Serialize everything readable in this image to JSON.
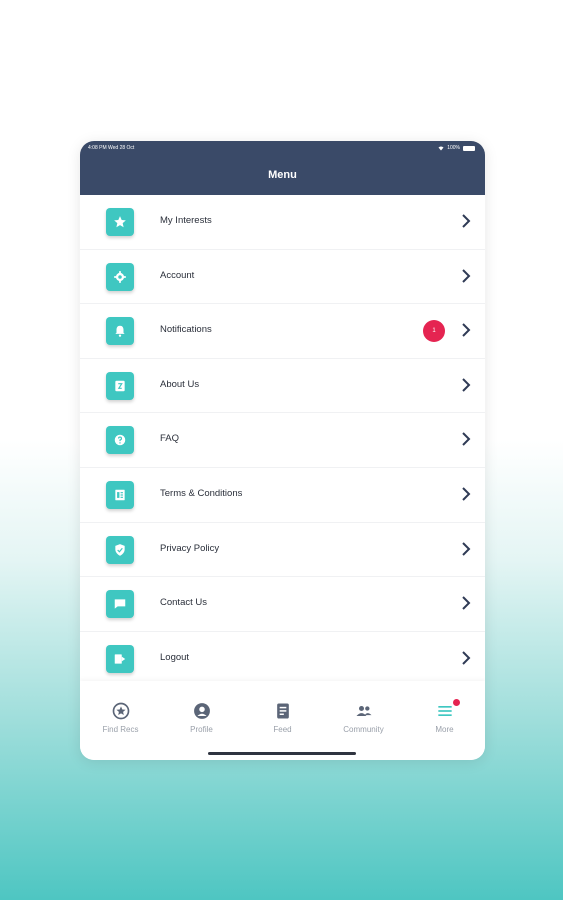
{
  "status": {
    "time": "4:08 PM  Wed 28 Oct",
    "battery": "100%"
  },
  "header": {
    "title": "Menu"
  },
  "menu": {
    "items": [
      {
        "label": "My Interests",
        "icon": "star-icon"
      },
      {
        "label": "Account",
        "icon": "gear-icon"
      },
      {
        "label": "Notifications",
        "icon": "bell-icon",
        "badge": "1"
      },
      {
        "label": "About Us",
        "icon": "info-document-icon"
      },
      {
        "label": "FAQ",
        "icon": "question-icon"
      },
      {
        "label": "Terms & Conditions",
        "icon": "terms-document-icon"
      },
      {
        "label": "Privacy Policy",
        "icon": "shield-check-icon"
      },
      {
        "label": "Contact Us",
        "icon": "chat-icon"
      },
      {
        "label": "Logout",
        "icon": "logout-icon"
      }
    ]
  },
  "tabbar": {
    "tabs": [
      {
        "label": "Find Recs",
        "icon": "star-circle-icon"
      },
      {
        "label": "Profile",
        "icon": "user-circle-icon"
      },
      {
        "label": "Feed",
        "icon": "feed-document-icon"
      },
      {
        "label": "Community",
        "icon": "people-icon"
      },
      {
        "label": "More",
        "icon": "hamburger-icon"
      }
    ]
  },
  "colors": {
    "accent": "#3fc7c1",
    "header": "#3a4a68",
    "badge": "#e52451",
    "tab_active": "#3fc7c1",
    "tab_inactive": "#9aa0aa"
  }
}
